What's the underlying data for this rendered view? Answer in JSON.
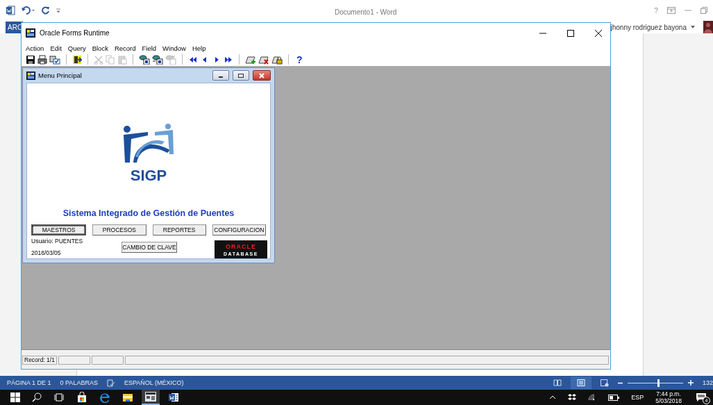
{
  "word": {
    "title": "Documento1 - Word",
    "help": "?",
    "ribbon_tab": "ARC",
    "user": "jhonny rodriguez bayona",
    "status": {
      "page": "PÁGINA 1 DE 1",
      "words": "0 PALABRAS",
      "language": "ESPAÑOL (MÉXICO)",
      "zoom": {
        "level": 0.55,
        "reading": "132"
      }
    }
  },
  "forms_window": {
    "title": "Oracle Forms Runtime",
    "menu": [
      "Action",
      "Edit",
      "Query",
      "Block",
      "Record",
      "Field",
      "Window",
      "Help"
    ],
    "toolbar": [
      [
        {
          "disabled": false
        },
        {
          "disabled": false
        },
        {
          "disabled": false
        }
      ],
      [
        {
          "disabled": false
        }
      ],
      [
        {
          "disabled": true
        },
        {
          "disabled": true
        },
        {
          "disabled": true
        }
      ],
      [
        {
          "disabled": false
        },
        {
          "disabled": false
        },
        {
          "disabled": true
        }
      ],
      [
        {
          "disabled": false
        },
        {
          "disabled": false
        },
        {
          "disabled": false
        },
        {
          "disabled": false
        }
      ],
      [
        {
          "disabled": false
        },
        {
          "disabled": false
        },
        {
          "disabled": false
        }
      ]
    ],
    "help": "?",
    "status_bar": [
      "Record: 1/1"
    ]
  },
  "menu_window": {
    "title": "Menu Principal",
    "logo_text": "SIGP",
    "heading": "Sistema Integrado de Gestión de Puentes",
    "buttons": [
      {
        "label": "MAESTROS",
        "focused": true
      },
      {
        "label": "PROCESOS",
        "focused": false
      },
      {
        "label": "REPORTES",
        "focused": false
      },
      {
        "label": "CONFIGURACION",
        "focused": false
      }
    ],
    "user": "Usuario: PUENTES",
    "date": "2018/03/05",
    "password_button": {
      "label": "CAMBIO DE CLAVE",
      "focused": false
    },
    "oracle_logo": {
      "brand": "ORACLE",
      "product": "DATABASE"
    }
  },
  "taskbar": {
    "apps": [
      {
        "active": false
      },
      {
        "active": false
      },
      {
        "active": false
      },
      {
        "active": true
      },
      {
        "active": false
      }
    ],
    "language": "ESP",
    "time": "7:44 p.m.",
    "date": "5/03/2018",
    "notifications": "4"
  }
}
